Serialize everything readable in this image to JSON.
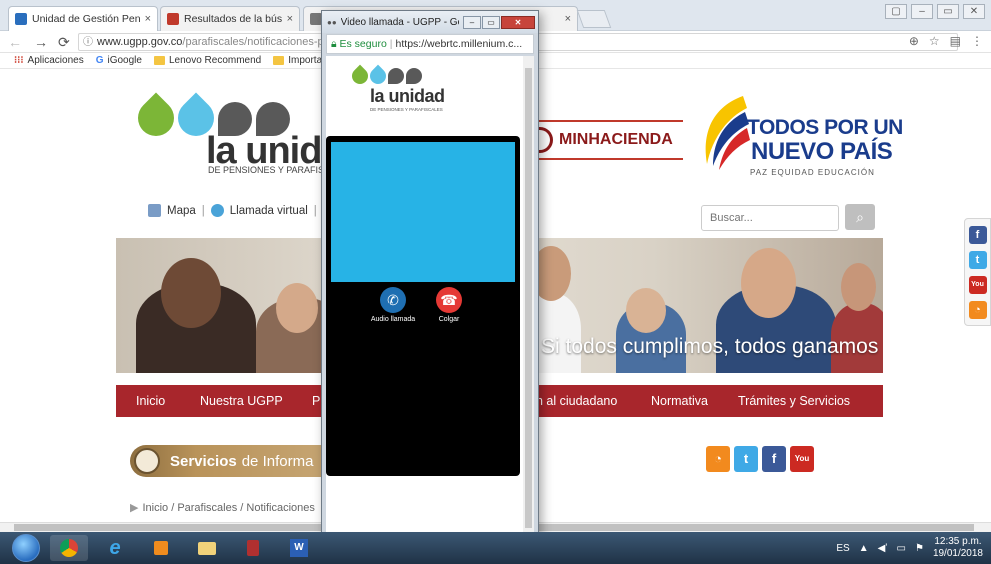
{
  "browser": {
    "tabs": [
      {
        "title": "Unidad de Gestión Pens",
        "favicon_color": "#2a6ebd"
      },
      {
        "title": "Resultados de la búsque",
        "favicon_color": "#c0392b"
      },
      {
        "title": "",
        "favicon_color": "#777777"
      }
    ],
    "address": {
      "host": "www.ugpp.gov.co",
      "path": "/parafiscales/notificaciones-para"
    },
    "bookmarks": [
      "Aplicaciones",
      "iGoogle",
      "Lenovo Recommend",
      "Importados"
    ]
  },
  "page": {
    "logo_text": "la unidad",
    "logo_sub": "DE PENSIONES Y PARAFISCA",
    "minhacienda": "MINHACIENDA",
    "todos": {
      "line1": "TODOS POR UN",
      "line2": "NUEVO PAÍS",
      "line3": "PAZ  EQUIDAD  EDUCACIÓN"
    },
    "util_links": {
      "mapa": "Mapa",
      "llamada": "Llamada virtual"
    },
    "search_placeholder": "Buscar...",
    "banner_caption": "Si todos cumplimos, todos ganamos",
    "nav": [
      "Inicio",
      "Nuestra UGPP",
      "P",
      "n al ciudadano",
      "Normativa",
      "Trámites y Servicios"
    ],
    "servicios": {
      "bold": "Servicios",
      "rest": "de Informa"
    },
    "breadcrumb": "Inicio / Parafiscales / Notificaciones"
  },
  "popup": {
    "title": "Video llamada - UGPP - Goo...",
    "secure_label": "Es seguro",
    "url": "https://webrtc.millenium.c...",
    "logo_text": "la unidad",
    "logo_sub": "DE PENSIONES Y PARAFISCALES",
    "audio_label": "Audio llamada",
    "hangup_label": "Colgar"
  },
  "taskbar": {
    "language": "ES",
    "time": "12:35 p.m.",
    "date": "19/01/2018"
  },
  "colors": {
    "nav_red": "#a8262c",
    "video_blue": "#27b3e6",
    "call_blue": "#1f6fb2",
    "hangup_red": "#e53935",
    "logo_green": "#7cb637",
    "logo_cyan": "#5bc2e7"
  },
  "icons": [
    "search-icon",
    "reload-icon",
    "back-arrow-icon",
    "forward-arrow-icon",
    "star-icon",
    "zoom-icon",
    "menu-icon",
    "lock-icon",
    "phone-icon",
    "hangup-icon",
    "facebook-icon",
    "twitter-icon",
    "youtube-icon",
    "rss-icon"
  ]
}
